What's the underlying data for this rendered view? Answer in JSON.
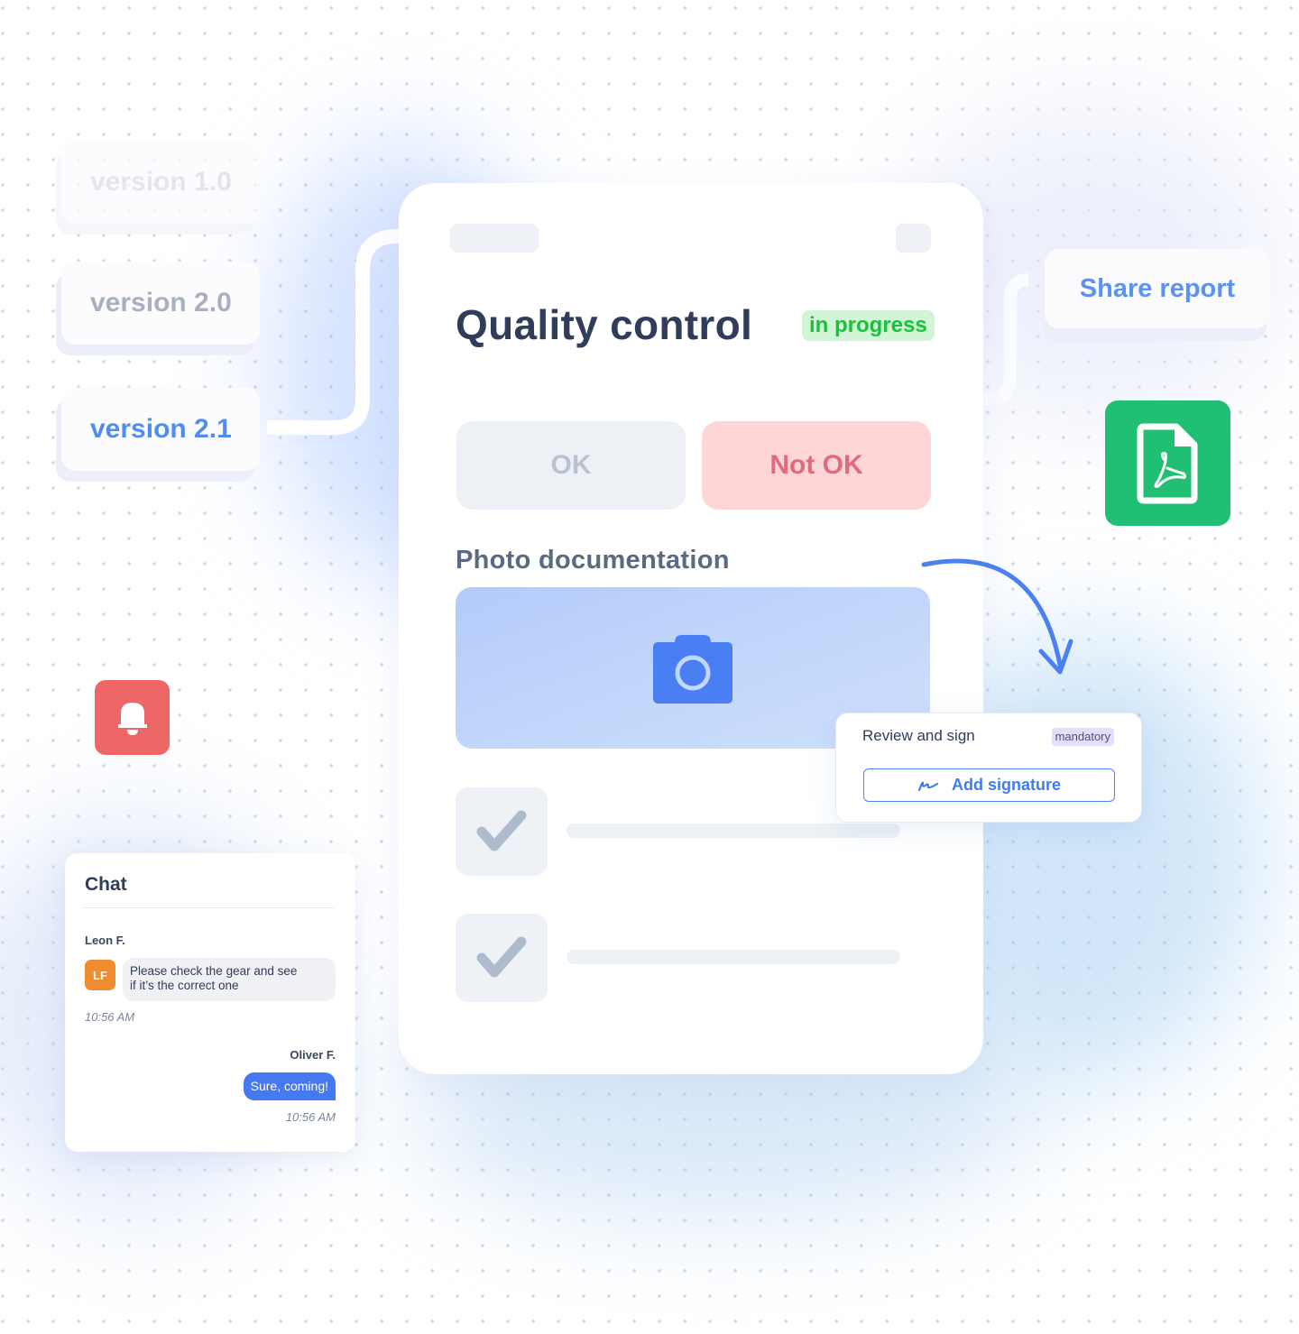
{
  "versions": [
    {
      "label": "version 1.0",
      "state": "faded"
    },
    {
      "label": "version 2.0",
      "state": "inactive"
    },
    {
      "label": "version 2.1",
      "state": "active"
    }
  ],
  "main_card": {
    "title": "Quality control",
    "status_badge": "in progress",
    "choices": {
      "ok": "OK",
      "not_ok": "Not OK"
    },
    "section_title": "Photo documentation",
    "photo_icon": "camera-icon",
    "checklist_icon": "checkmark-icon"
  },
  "share": {
    "label": "Share report"
  },
  "pdf_tile": {
    "icon": "pdf-file-icon"
  },
  "notification": {
    "icon": "bell-icon"
  },
  "review": {
    "title": "Review and sign",
    "badge": "mandatory",
    "button_label": "Add signature",
    "button_icon": "signature-icon"
  },
  "chat": {
    "title": "Chat",
    "messages": [
      {
        "sender": "Leon F.",
        "initials": "LF",
        "text_line1": "Please check the gear and see",
        "text_line2": "if it’s the correct one",
        "time": "10:56 AM"
      },
      {
        "sender": "Oliver F.",
        "text": "Sure, coming!",
        "time": "10:56 AM"
      }
    ]
  },
  "colors": {
    "accent_blue": "#4f8df5",
    "status_green": "#18c23a",
    "pdf_green": "#21bf73",
    "alert_red": "#ec6766",
    "not_ok_red": "#e16b7d",
    "avatar_orange": "#ef8c2f",
    "title_navy": "#2f3d5a"
  }
}
